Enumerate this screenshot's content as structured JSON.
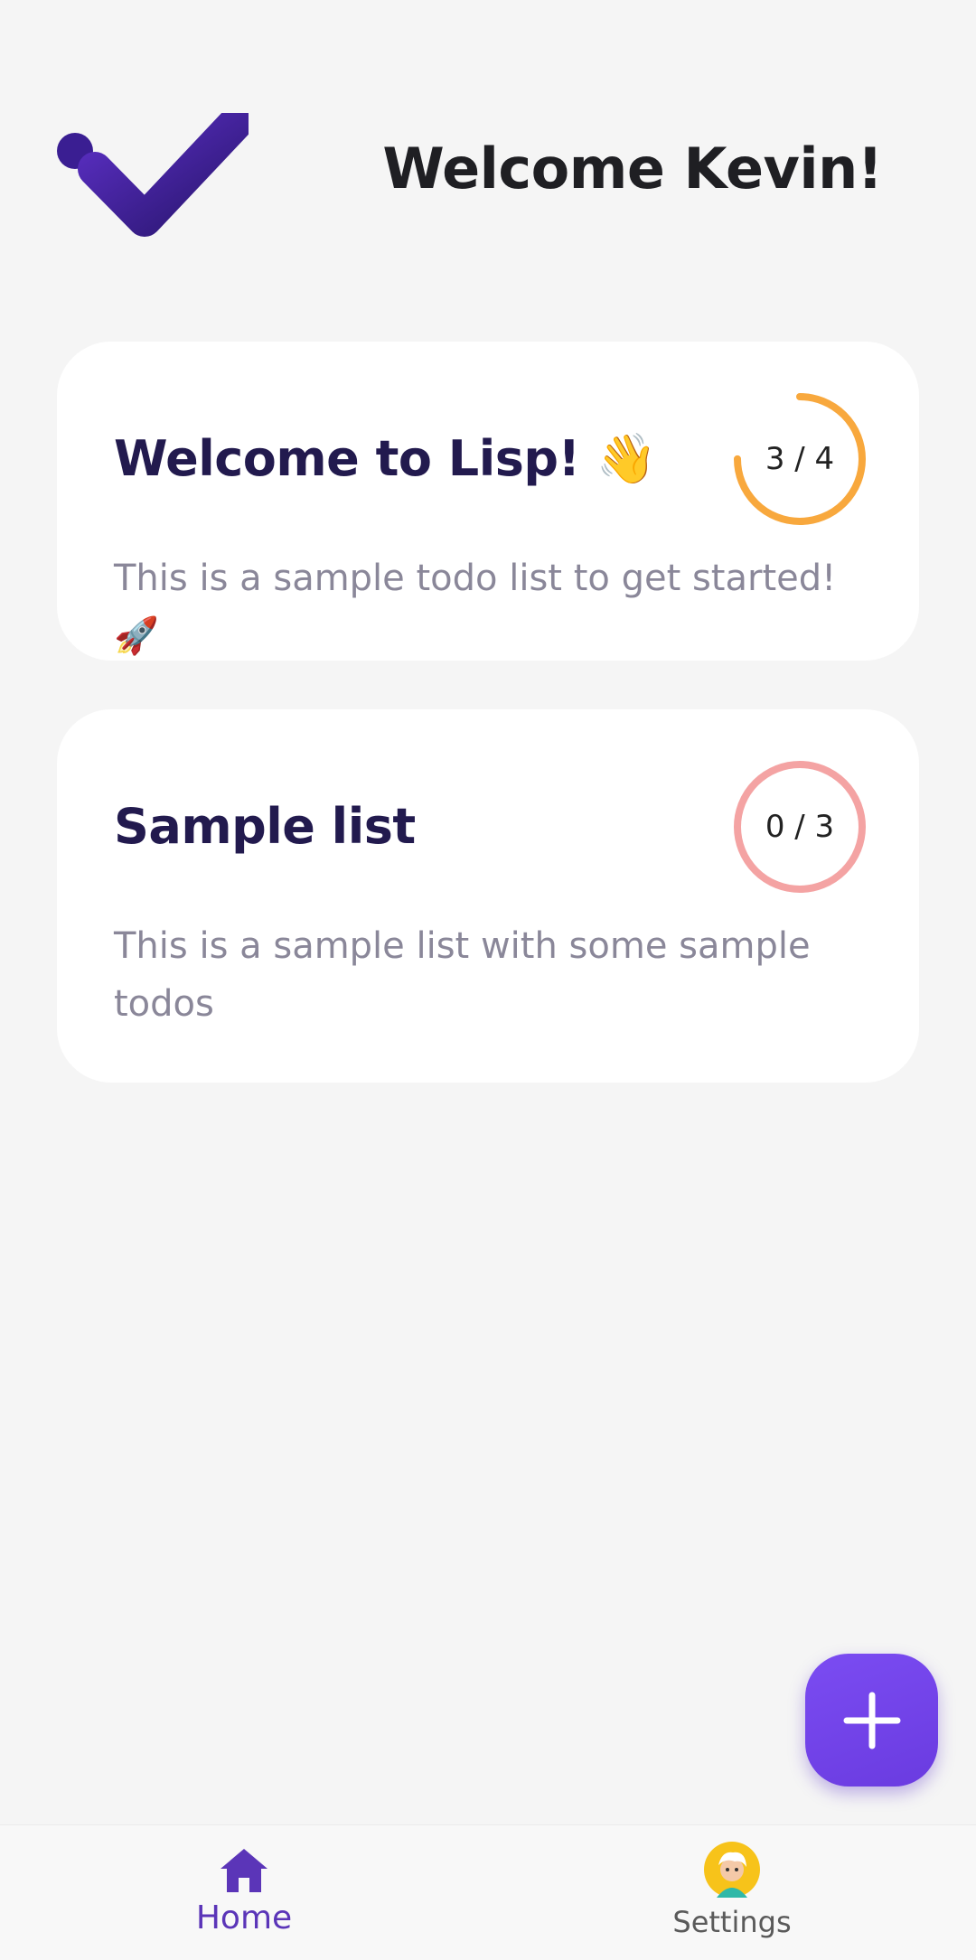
{
  "header": {
    "title": "Welcome Kevin!",
    "logo_icon": "checkmark-logo-icon"
  },
  "lists": [
    {
      "title": "Welcome to Lisp! 👋",
      "description": "This is a sample todo list to get started! 🚀",
      "progress_label": "3 / 4",
      "completed": 3,
      "total": 4,
      "color": "#f8a83d"
    },
    {
      "title": "Sample list",
      "description": "This is a sample list with some sample todos",
      "progress_label": "0 / 3",
      "completed": 0,
      "total": 3,
      "color": "#f4a3a3"
    }
  ],
  "fab": {
    "icon": "plus-icon"
  },
  "nav": {
    "home_label": "Home",
    "home_icon": "home-icon",
    "settings_label": "Settings",
    "settings_icon": "avatar-icon"
  },
  "colors": {
    "accent": "#6a3be0",
    "title": "#221a4e",
    "background": "#f5f5f5"
  }
}
